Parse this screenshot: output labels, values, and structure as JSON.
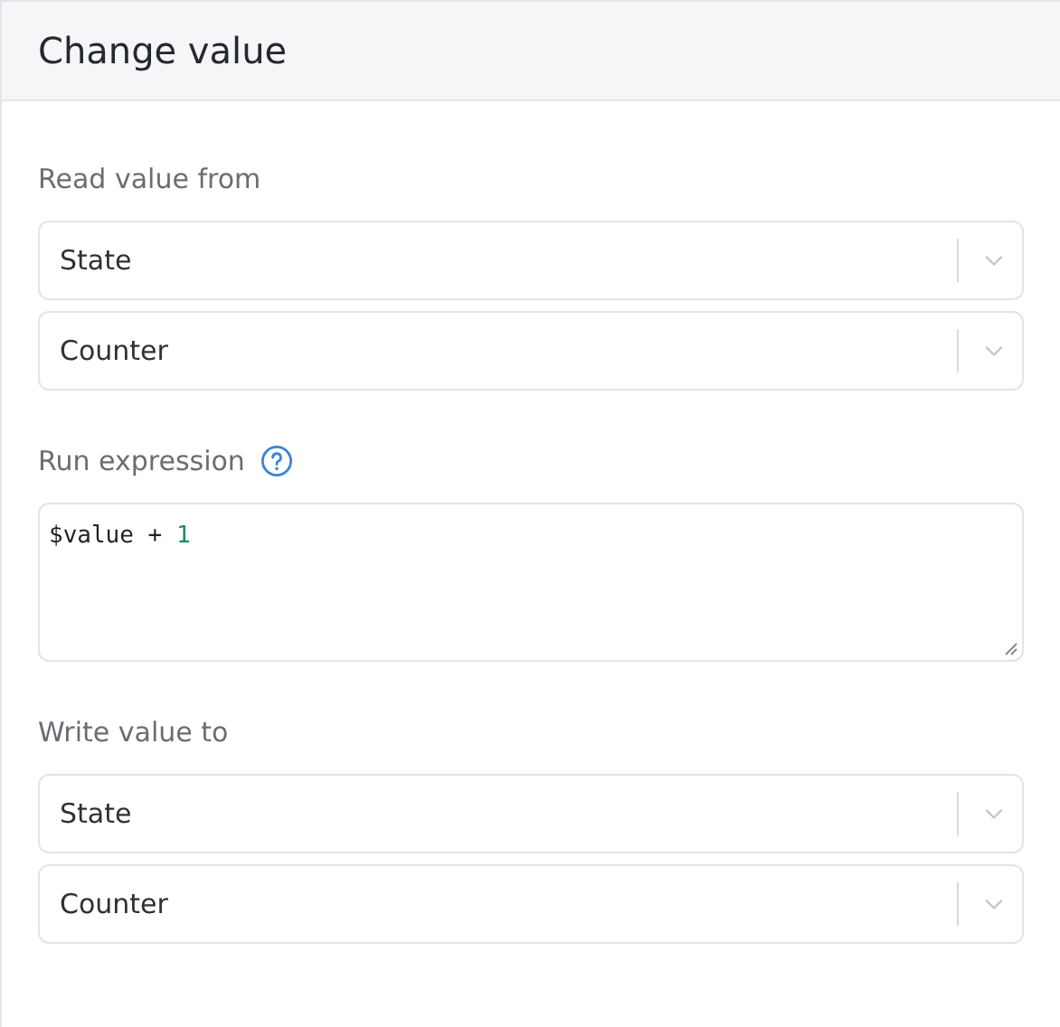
{
  "panel": {
    "title": "Change value"
  },
  "sections": [
    {
      "kind": "selects",
      "label": "Read value from",
      "selects": [
        {
          "value": "State"
        },
        {
          "value": "Counter"
        }
      ]
    },
    {
      "kind": "expression",
      "label": "Run expression",
      "help": true,
      "tokens": [
        {
          "text": "$value + ",
          "kind": "plain"
        },
        {
          "text": "1",
          "kind": "number"
        }
      ]
    },
    {
      "kind": "selects",
      "label": "Write value to",
      "selects": [
        {
          "value": "State"
        },
        {
          "value": "Counter"
        }
      ]
    }
  ]
}
